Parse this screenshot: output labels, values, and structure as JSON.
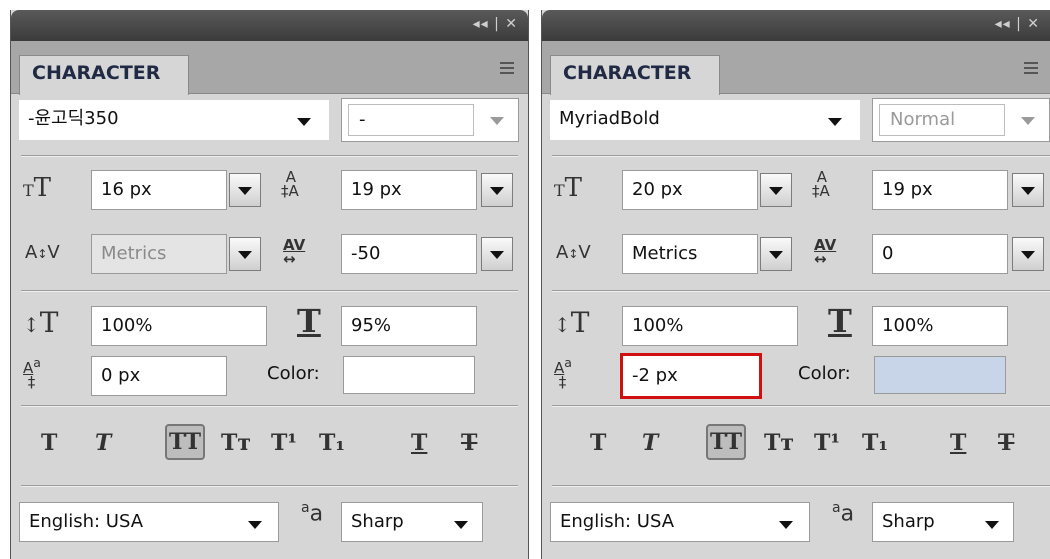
{
  "panel_controls": "◂◂ | ✕",
  "left": {
    "tab_label": "CHARACTER",
    "font_family": "-윤고딕350",
    "font_style": "-",
    "font_size": "16 px",
    "leading": "19 px",
    "kerning": "Metrics",
    "tracking": "-50",
    "vertical_scale": "100%",
    "horizontal_scale": "95%",
    "baseline_shift": "0 px",
    "color_label": "Color:",
    "color_value": "#ffffff",
    "language": "English: USA",
    "antialias": "Sharp"
  },
  "right": {
    "tab_label": "CHARACTER",
    "font_family": "MyriadBold",
    "font_style": "Normal",
    "font_size": "20 px",
    "leading": "19 px",
    "kerning": "Metrics",
    "tracking": "0",
    "vertical_scale": "100%",
    "horizontal_scale": "100%",
    "baseline_shift": "-2 px",
    "color_label": "Color:",
    "color_value": "#c8d4e8",
    "language": "English: USA",
    "antialias": "Sharp"
  },
  "icons": {
    "font_size": "tT",
    "leading": "A/A",
    "kerning": "A/V",
    "tracking": "AV",
    "vertical_scale": "↕T",
    "horizontal_scale": "T",
    "baseline_shift": "Aª",
    "antialias": "ªa"
  },
  "style_buttons": {
    "faux_bold": "T",
    "faux_italic": "T",
    "all_caps": "TT",
    "small_caps": "Tт",
    "superscript": "T¹",
    "subscript": "T₁",
    "underline": "T",
    "strikethrough": "T"
  },
  "highlight_color": "#d01010"
}
